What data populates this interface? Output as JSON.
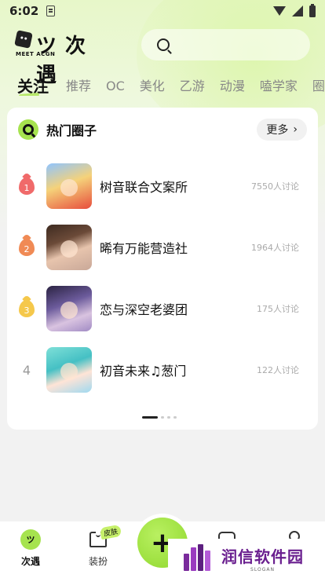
{
  "status_bar": {
    "time": "6:02"
  },
  "header": {
    "logo_text": "ツ 次遇",
    "logo_sub": "MEET ACGN",
    "search_placeholder": ""
  },
  "tabs": [
    {
      "label": "关注",
      "active": true
    },
    {
      "label": "推荐"
    },
    {
      "label": "OC"
    },
    {
      "label": "美化"
    },
    {
      "label": "乙游"
    },
    {
      "label": "动漫"
    },
    {
      "label": "嗑学家"
    },
    {
      "label": "圈"
    }
  ],
  "hot_circles": {
    "title": "热门圈子",
    "more_label": "更多",
    "items": [
      {
        "rank": "1",
        "name": "树音联合文案所",
        "count": "7550人讨论"
      },
      {
        "rank": "2",
        "name": "晞有万能营造社",
        "count": "1964人讨论"
      },
      {
        "rank": "3",
        "name": "恋与深空老婆团",
        "count": "175人讨论"
      },
      {
        "rank": "4",
        "name": "初音未来♫葱门",
        "count": "122人讨论"
      }
    ]
  },
  "bottom_nav": {
    "items": [
      {
        "label": "次遇",
        "icon": "meet-icon",
        "active": true
      },
      {
        "label": "装扮",
        "icon": "shirt-icon",
        "badge": "皮肤"
      },
      {
        "label": "",
        "icon": "plus-icon"
      },
      {
        "label": "",
        "icon": "message-icon"
      },
      {
        "label": "",
        "icon": "profile-icon"
      }
    ]
  },
  "watermark": {
    "title": "润信软件园",
    "slogan": "SLOGAN"
  }
}
